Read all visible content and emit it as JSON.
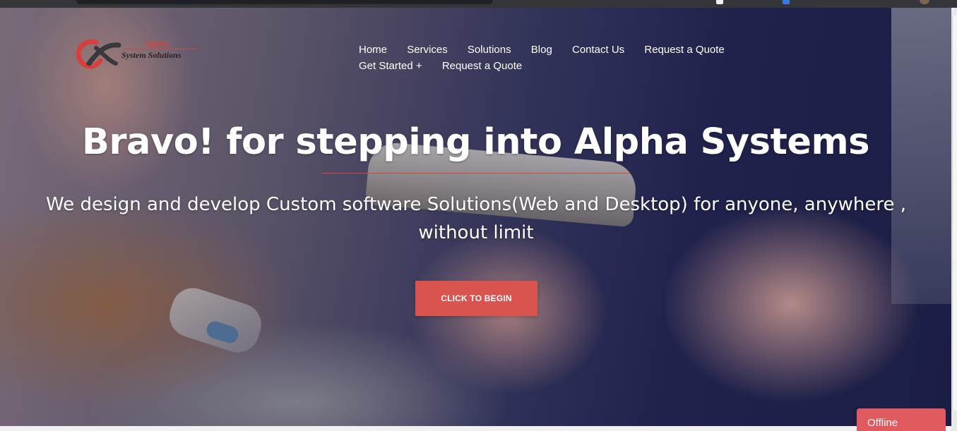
{
  "logo": {
    "brand_top": "Alpha",
    "brand_bottom": "System Solutions"
  },
  "nav": {
    "items": [
      "Home",
      "Services",
      "Solutions",
      "Blog",
      "Contact Us",
      "Request a Quote",
      "Get Started +",
      "Request a Quote"
    ]
  },
  "hero": {
    "title": "Bravo! for stepping into Alpha Systems",
    "subtitle": "We design and develop Custom software Solutions(Web and Desktop) for anyone, anywhere , without limit",
    "cta_label": "CLICK TO BEGIN"
  },
  "chat": {
    "status_label": "Offline"
  },
  "colors": {
    "accent": "#d9534f",
    "chat_tab": "#e05a5f",
    "hero_dark": "#1d2049"
  }
}
